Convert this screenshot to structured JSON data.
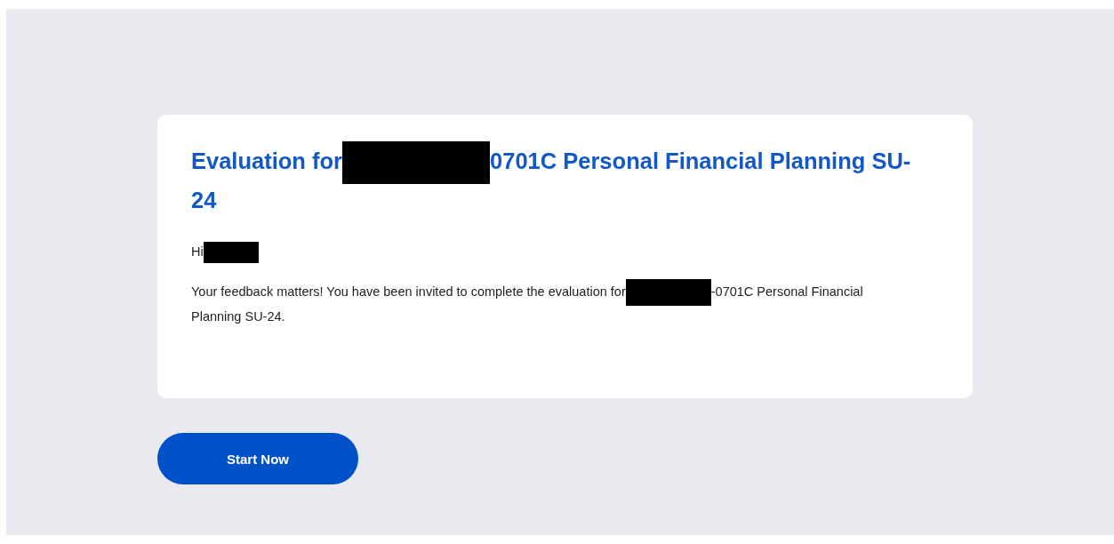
{
  "card": {
    "title": [
      {
        "kind": "text",
        "text": "Evaluation for"
      },
      {
        "kind": "redaction"
      },
      {
        "kind": "text",
        "text": "0701C Personal Financial Planning SU-"
      },
      {
        "kind": "break"
      },
      {
        "kind": "text",
        "text": "24"
      }
    ],
    "greeting": [
      {
        "kind": "text",
        "text": "Hi"
      },
      {
        "kind": "redaction"
      }
    ],
    "message": [
      {
        "kind": "text",
        "text": "Your feedback matters! You have been invited to complete the evaluation for"
      },
      {
        "kind": "redaction"
      },
      {
        "kind": "text",
        "text": "-0701C Personal Financial"
      },
      {
        "kind": "break"
      },
      {
        "kind": "text",
        "text": "Planning SU-24."
      }
    ]
  },
  "button": {
    "label": "Start Now"
  }
}
